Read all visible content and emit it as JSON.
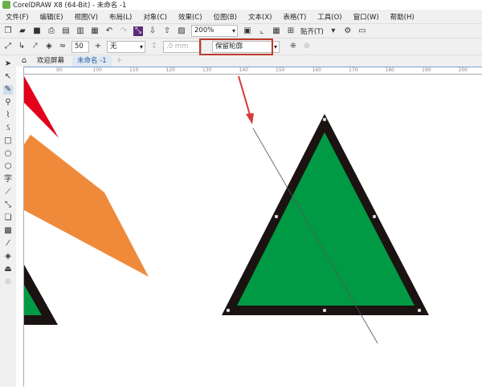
{
  "window": {
    "title": "CorelDRAW X8 (64-Bit) - 未命名 -1"
  },
  "menu": [
    "文件(F)",
    "编辑(E)",
    "视图(V)",
    "布局(L)",
    "对象(C)",
    "效果(C)",
    "位图(B)",
    "文本(X)",
    "表格(T)",
    "工具(O)",
    "窗口(W)",
    "帮助(H)"
  ],
  "toolbar": {
    "zoom": "200%",
    "snap": "贴齐(T)"
  },
  "propbar": {
    "steps": "50",
    "style": "无",
    "width": ".0 mm",
    "contour_mode": "保留轮廓"
  },
  "tabs": [
    {
      "label": "欢迎屏幕"
    },
    {
      "label": "未命名 -1"
    }
  ],
  "ruler": [
    "90",
    "100",
    "110",
    "120",
    "130",
    "140",
    "150",
    "160",
    "170",
    "180",
    "190",
    "200"
  ],
  "colors": {
    "accent_highlight": "#c0392b",
    "triangle_fill": "#009a44",
    "triangle_outline": "#1a1311",
    "red_shape": "#e3001b",
    "orange_shape": "#ef8a3a"
  }
}
